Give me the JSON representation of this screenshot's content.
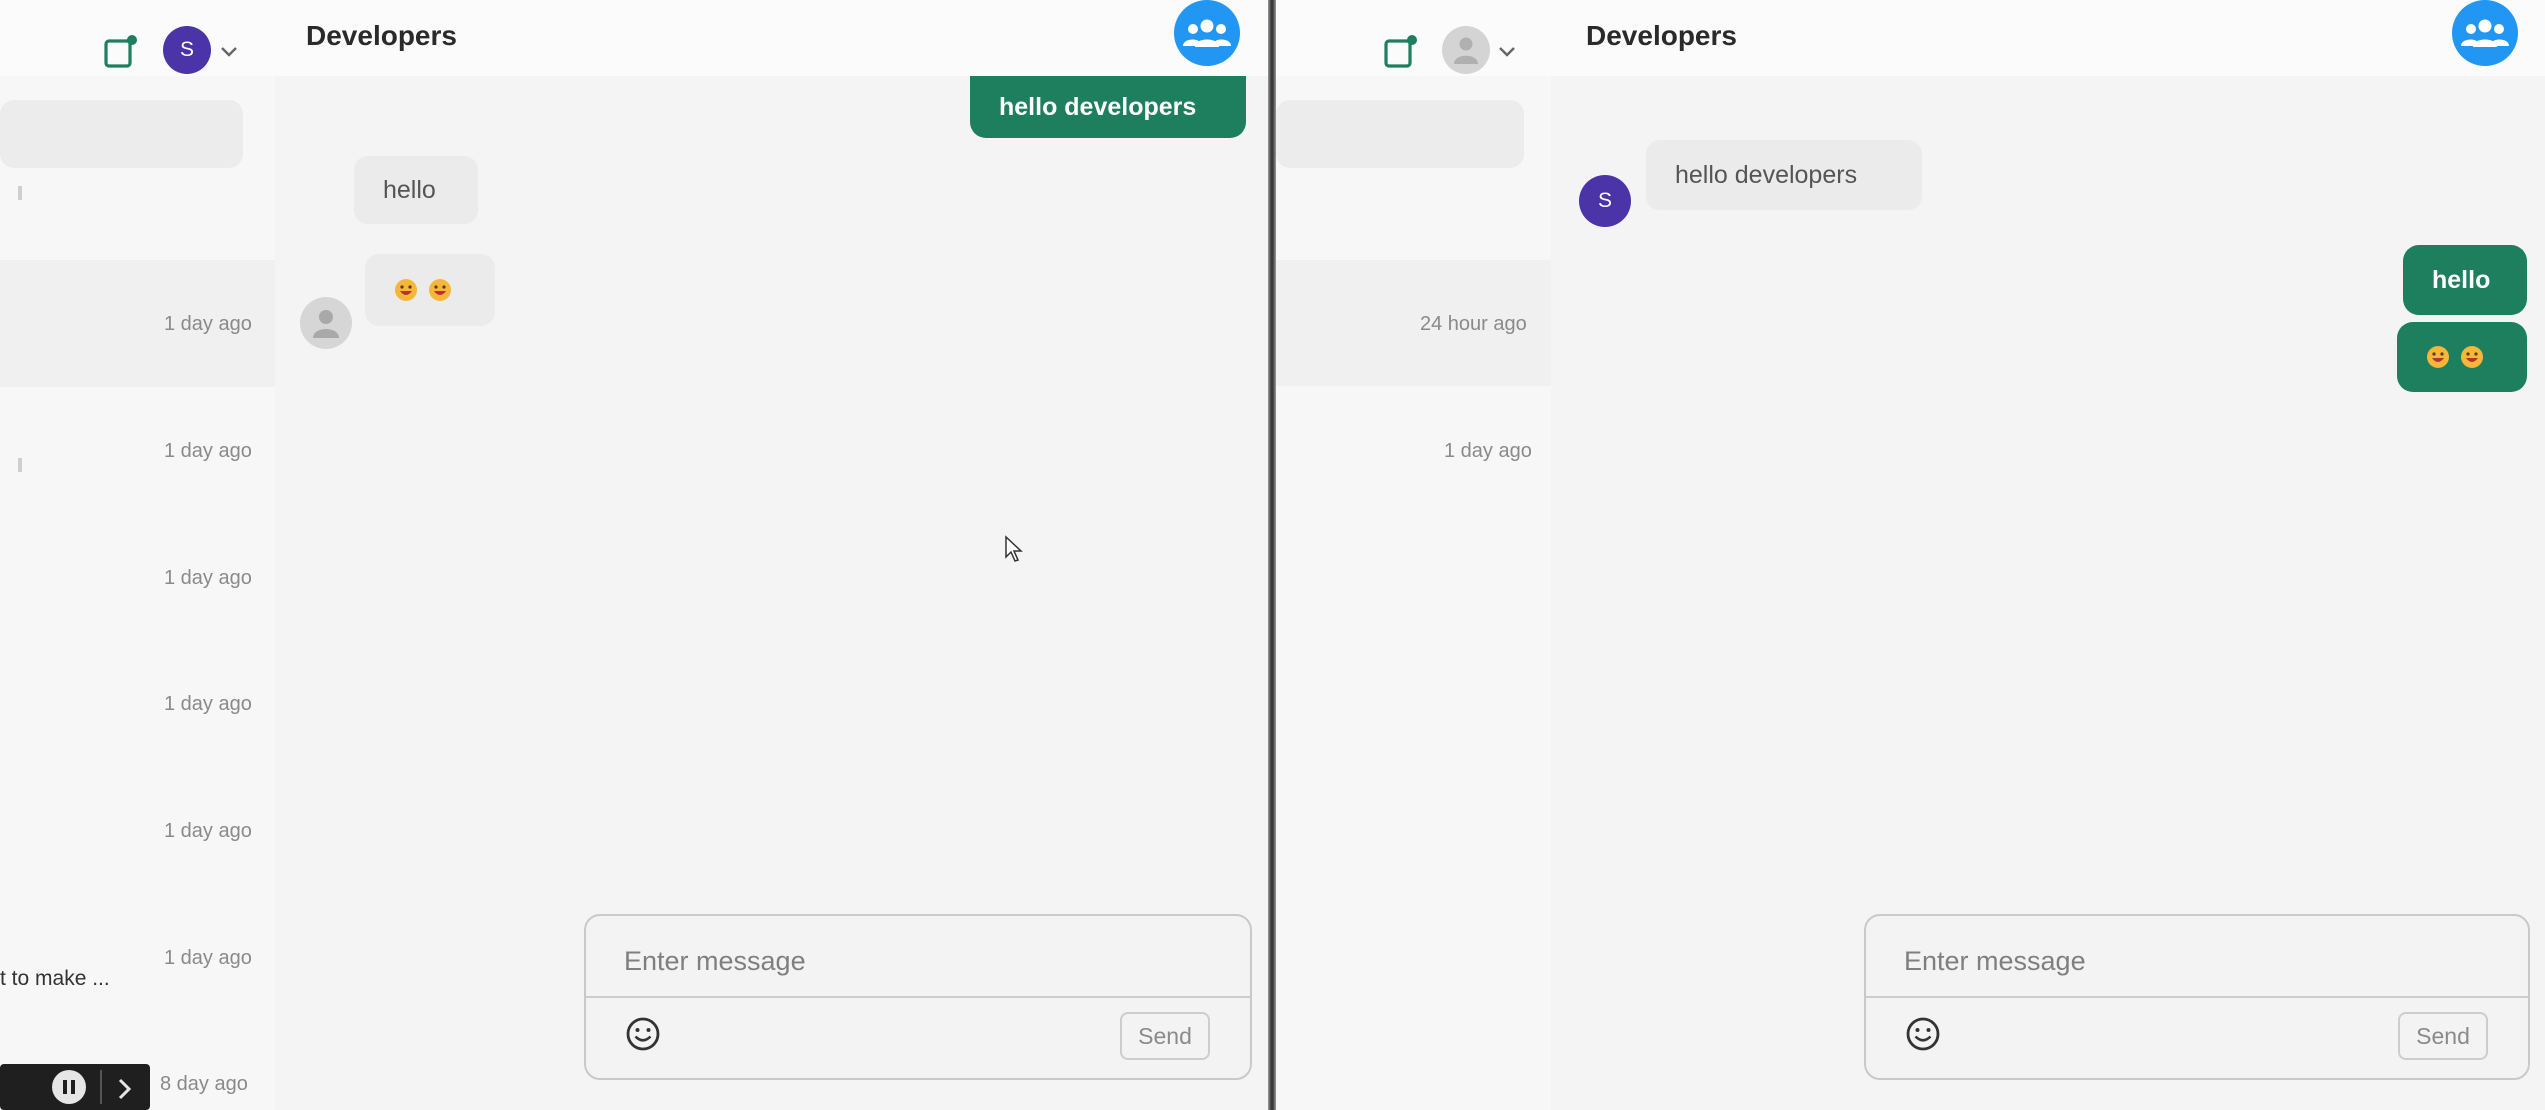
{
  "left": {
    "chat_title": "Developers",
    "avatar_initial": "S",
    "conversation_times": [
      "1 day ago",
      "1 day ago",
      "1 day ago",
      "1 day ago",
      "1 day ago",
      "1 day ago",
      "8 day ago"
    ],
    "conversation_preview": "t to make ...",
    "messages": {
      "outgoing": "hello developers",
      "incoming": "hello"
    },
    "composer": {
      "placeholder": "Enter message",
      "send_label": "Send"
    }
  },
  "right": {
    "chat_title": "Developers",
    "sender_initial": "S",
    "conversation_times": [
      "24 hour ago",
      "1 day ago"
    ],
    "messages": {
      "incoming": "hello developers",
      "outgoing": "hello"
    },
    "composer": {
      "placeholder": "Enter message",
      "send_label": "Send"
    }
  },
  "colors": {
    "brand_green": "#1d7f5e",
    "avatar_purple": "#4b33a8",
    "group_blue": "#2196f3"
  },
  "icons": [
    "compose-icon",
    "chevron-down-icon",
    "group-icon",
    "smiley-icon",
    "user-icon",
    "grinning-emoji-icon",
    "pause-icon",
    "next-icon",
    "cursor-icon"
  ]
}
